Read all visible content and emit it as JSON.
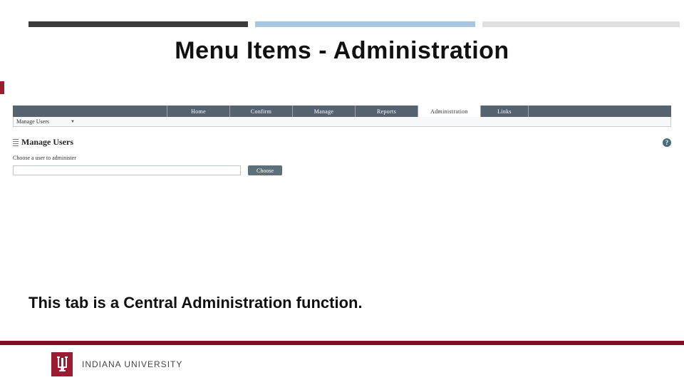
{
  "slide": {
    "title": "Menu Items - Administration",
    "caption": "This tab is a Central Administration function."
  },
  "nav": {
    "tabs": [
      {
        "label": "Home",
        "active": false
      },
      {
        "label": "Confirm",
        "active": false
      },
      {
        "label": "Manage",
        "active": false
      },
      {
        "label": "Reports",
        "active": false
      },
      {
        "label": "Administration",
        "active": true
      },
      {
        "label": "Links",
        "active": false
      }
    ],
    "sub_tab": "Manage Users"
  },
  "panel": {
    "title": "Manage Users",
    "instruction": "Choose a user to administer",
    "input_value": "",
    "choose_label": "Choose",
    "help_glyph": "?"
  },
  "footer": {
    "institution": "INDIANA UNIVERSITY"
  },
  "colors": {
    "crimson": "#9b1b30",
    "nav_bg": "#556270",
    "accent_blue": "#a6c6e3"
  }
}
